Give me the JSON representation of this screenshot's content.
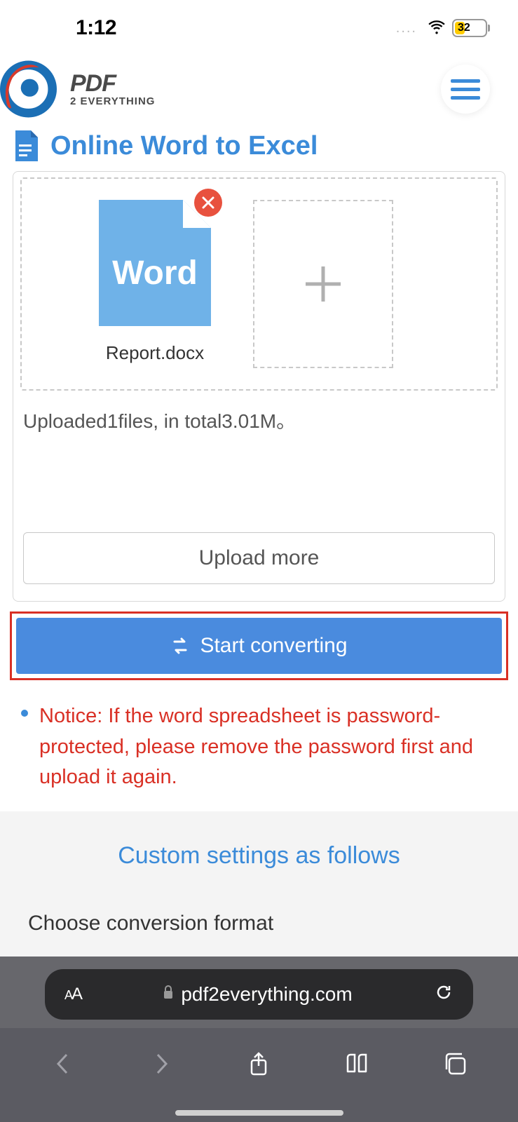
{
  "status": {
    "time": "1:12",
    "battery": "32"
  },
  "brand": {
    "main": "PDF",
    "sub": "2 EVERYTHING"
  },
  "page": {
    "title": "Online Word to Excel"
  },
  "file": {
    "type_label": "Word",
    "name": "Report.docx"
  },
  "status_line": "Uploaded1files, in total3.01M。",
  "buttons": {
    "upload_more": "Upload more",
    "start": "Start converting"
  },
  "notice": "Notice: If the word spreadsheet is password-protected, please remove the password first and upload it again.",
  "custom": {
    "heading": "Custom settings as follows",
    "format_label": "Choose conversion format"
  },
  "browser": {
    "url": "pdf2everything.com",
    "aa_small": "A",
    "aa_big": "A"
  }
}
